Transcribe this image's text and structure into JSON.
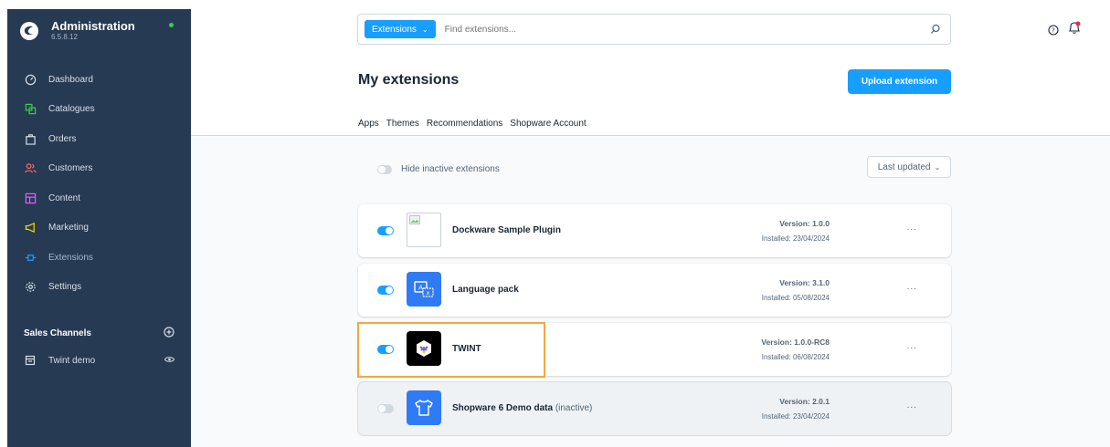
{
  "brand": {
    "title": "Administration",
    "version": "6.5.8.12",
    "status_color": "#37d046"
  },
  "sidebar": {
    "items": [
      {
        "label": "Dashboard",
        "icon": "dashboard-icon",
        "color": "#d7dfe9"
      },
      {
        "label": "Catalogues",
        "icon": "catalogues-icon",
        "color": "#37d046"
      },
      {
        "label": "Orders",
        "icon": "orders-icon",
        "color": "#a6b4c6"
      },
      {
        "label": "Customers",
        "icon": "customers-icon",
        "color": "#ff6a6a"
      },
      {
        "label": "Content",
        "icon": "content-icon",
        "color": "#e25cff"
      },
      {
        "label": "Marketing",
        "icon": "marketing-icon",
        "color": "#ffd700"
      },
      {
        "label": "Extensions",
        "icon": "extensions-icon",
        "color": "#189eff"
      },
      {
        "label": "Settings",
        "icon": "settings-icon",
        "color": "#a6b4c6"
      }
    ],
    "sales_channels_label": "Sales Channels",
    "sales_channels": [
      {
        "label": "Twint demo"
      }
    ]
  },
  "search": {
    "type_label": "Extensions",
    "placeholder": "Find extensions..."
  },
  "page": {
    "title": "My extensions",
    "upload_label": "Upload extension",
    "tabs": [
      {
        "label": "Apps",
        "active": true
      },
      {
        "label": "Themes",
        "active": false
      },
      {
        "label": "Recommendations",
        "active": false
      },
      {
        "label": "Shopware Account",
        "active": false
      }
    ],
    "hide_inactive_label": "Hide inactive extensions",
    "sort_label": "Last updated"
  },
  "extensions": [
    {
      "name": "Dockware Sample Plugin",
      "version": "Version: 1.0.0",
      "installed": "Installed: 23/04/2024",
      "active": true,
      "icon": "broken-image-icon",
      "more": "..."
    },
    {
      "name": "Language pack",
      "version": "Version: 3.1.0",
      "installed": "Installed: 05/08/2024",
      "active": true,
      "icon": "language-pack-icon",
      "more": "..."
    },
    {
      "name": "TWINT",
      "version": "Version: 1.0.0-RC8",
      "installed": "Installed: 06/08/2024",
      "active": true,
      "icon": "twint-logo-icon",
      "more": "..."
    },
    {
      "name": "Shopware 6 Demo data",
      "inactive_tag": "(inactive)",
      "version": "Version: 2.0.1",
      "installed": "Installed: 23/04/2024",
      "active": false,
      "icon": "tshirt-icon",
      "more": "..."
    }
  ]
}
